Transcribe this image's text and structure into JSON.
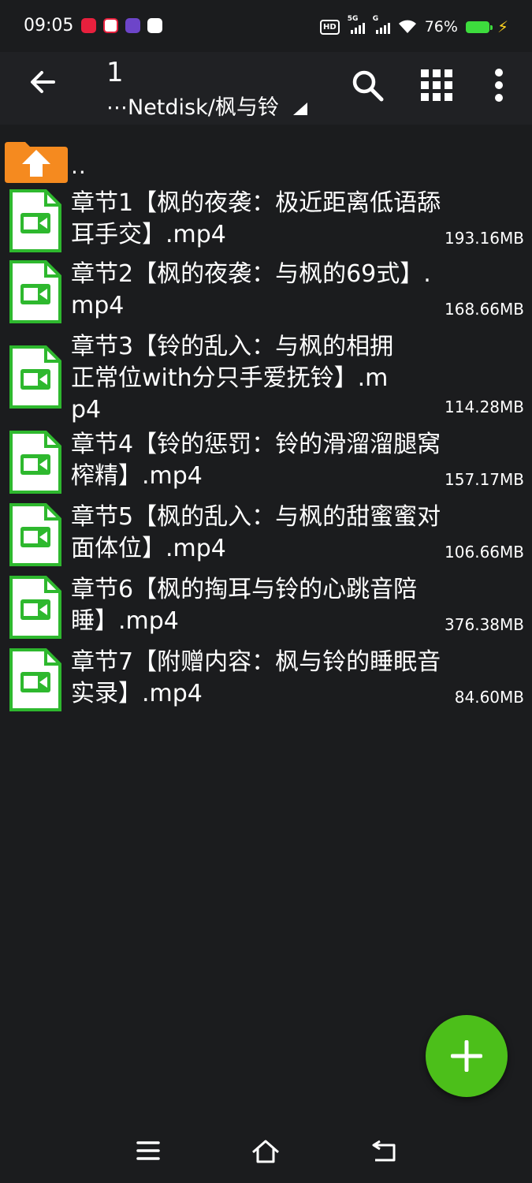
{
  "status": {
    "time": "09:05",
    "battery": "76%",
    "signal_labels": [
      "5G",
      "G"
    ]
  },
  "toolbar": {
    "title": "1",
    "path": "⋯Netdisk/枫与铃"
  },
  "parent": {
    "label": ".."
  },
  "files": [
    {
      "name": "章节1【枫的夜袭：极近距离低语舔耳手交】.mp4",
      "size": "193.16MB"
    },
    {
      "name": "章节2【枫的夜袭：与枫的69式】.mp4",
      "size": "168.66MB"
    },
    {
      "name": "章节3【铃的乱入：与枫的相拥正常位with分只手爱抚铃】.mp4",
      "size": "114.28MB"
    },
    {
      "name": "章节4【铃的惩罚：铃的滑溜溜腿窝榨精】.mp4",
      "size": "157.17MB"
    },
    {
      "name": "章节5【枫的乱入：与枫的甜蜜蜜对面体位】.mp4",
      "size": "106.66MB"
    },
    {
      "name": "章节6【枫的掏耳与铃的心跳音陪睡】.mp4",
      "size": "376.38MB"
    },
    {
      "name": "章节7【附赠内容：枫与铃的睡眠音实录】.mp4",
      "size": "84.60MB"
    }
  ],
  "colors": {
    "background": "#1b1c1e",
    "toolbar": "#202124",
    "file_icon_green": "#2eb82e",
    "fab": "#4cbf1a",
    "folder_orange": "#f58a1f"
  },
  "icons": {
    "back": "arrow-left-icon",
    "search": "search-icon",
    "grid": "grid-view-icon",
    "more": "more-vert-icon",
    "fab": "plus-icon",
    "nav": [
      "menu-icon",
      "home-icon",
      "back-nav-icon"
    ]
  }
}
